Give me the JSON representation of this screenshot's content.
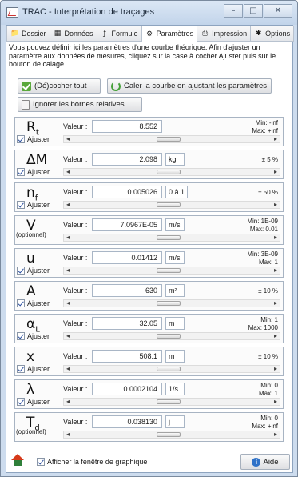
{
  "window": {
    "title": "TRAC - Interprétation de traçages",
    "minimize": "–",
    "maximize": "□",
    "close": "✕"
  },
  "tabs": [
    {
      "label": "Dossier",
      "icon": "folder-icon"
    },
    {
      "label": "Données",
      "icon": "table-icon"
    },
    {
      "label": "Formule",
      "icon": "formula-icon"
    },
    {
      "label": "Paramètres",
      "icon": "gear-icon"
    },
    {
      "label": "Impression",
      "icon": "printer-icon"
    },
    {
      "label": "Options",
      "icon": "options-icon"
    }
  ],
  "active_tab": "Paramètres",
  "intro_text": "Vous pouvez définir ici les paramètres d'une courbe théorique. Afin d'ajuster un paramètre aux données de mesures, cliquez sur la case à cocher Ajuster puis sur le bouton de calage.",
  "buttons": {
    "toggle_all": "(Dé)cocher tout",
    "fit_curve": "Caler la courbe en ajustant les paramètres",
    "ignore_bounds": "Ignorer les bornes relatives"
  },
  "value_label": "Valeur :",
  "adjust_label": "Ajuster",
  "optional_label": "(optionnel)",
  "params": [
    {
      "symbol": "R",
      "sub": "t",
      "value": "8.552",
      "unit": "",
      "range1": "Min: -inf",
      "range2": "Max: +inf",
      "adjust": true,
      "optional": false,
      "thumb": 0.48
    },
    {
      "symbol": "ΔM",
      "sub": "",
      "value": "2.098",
      "unit": "kg",
      "range1": "± 5 %",
      "range2": "",
      "adjust": true,
      "optional": false,
      "thumb": 0.48
    },
    {
      "symbol": "n",
      "sub": "f",
      "value": "0.005026",
      "unit": "0 à 1",
      "range1": "± 50 %",
      "range2": "",
      "adjust": true,
      "optional": false,
      "thumb": 0.48
    },
    {
      "symbol": "V",
      "sub": "",
      "value": "7.0967E-05",
      "unit": "m/s",
      "range1": "Min: 1E-09",
      "range2": "Max: 0.01",
      "adjust": false,
      "optional": true,
      "thumb": 0.48
    },
    {
      "symbol": "u",
      "sub": "",
      "value": "0.01412",
      "unit": "m/s",
      "range1": "Min: 3E-09",
      "range2": "Max: 1",
      "adjust": true,
      "optional": false,
      "thumb": 0.48
    },
    {
      "symbol": "A",
      "sub": "",
      "value": "630",
      "unit": "m²",
      "range1": "± 10 %",
      "range2": "",
      "adjust": true,
      "optional": false,
      "thumb": 0.48
    },
    {
      "symbol": "α",
      "sub": "L",
      "value": "32.05",
      "unit": "m",
      "range1": "Min: 1",
      "range2": "Max: 1000",
      "adjust": true,
      "optional": false,
      "thumb": 0.48
    },
    {
      "symbol": "x",
      "sub": "",
      "value": "508.1",
      "unit": "m",
      "range1": "± 10 %",
      "range2": "",
      "adjust": true,
      "optional": false,
      "thumb": 0.48
    },
    {
      "symbol": "λ",
      "sub": "",
      "value": "0.0002104",
      "unit": "1/s",
      "range1": "Min: 0",
      "range2": "Max: 1",
      "adjust": true,
      "optional": false,
      "thumb": 0.48
    },
    {
      "symbol": "T",
      "sub": "d",
      "value": "0.038130",
      "unit": "j",
      "range1": "Min: 0",
      "range2": "Max: +inf",
      "adjust": false,
      "optional": true,
      "thumb": 0.48
    }
  ],
  "footer": {
    "show_graph": "Afficher la fenêtre de graphique",
    "help": "Aide"
  }
}
